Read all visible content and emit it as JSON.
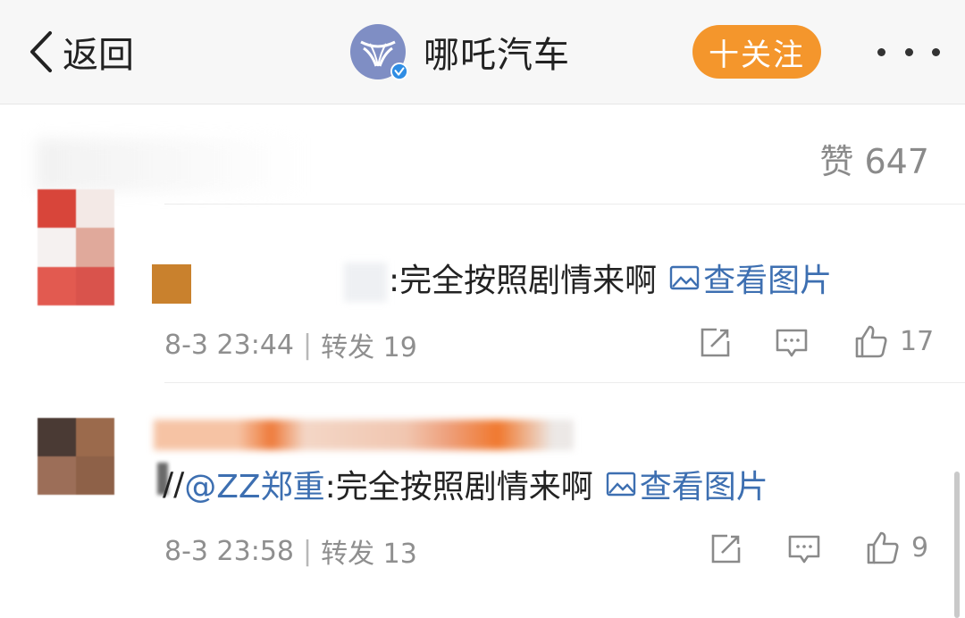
{
  "nav": {
    "back_label": "返回",
    "account_name": "哪吒汽车",
    "follow_label": "十关注",
    "brand_color": "#7f8ec4",
    "follow_color": "#f4962c"
  },
  "post": {
    "likes_label": "赞 647"
  },
  "comments": [
    {
      "text": ":完全按照剧情来啊",
      "image_link": "查看图片",
      "time": "8-3 23:44",
      "repost": "转发 19",
      "like_count": "17"
    },
    {
      "prefix": "//",
      "mention": "@ZZ郑重",
      "text": ":完全按照剧情来啊",
      "image_link": "查看图片",
      "time": "8-3 23:58",
      "repost": "转发 13",
      "like_count": "9"
    }
  ],
  "icons": [
    "back-chevron-icon",
    "brand-logo-icon",
    "verified-badge-icon",
    "more-icon",
    "image-icon",
    "share-icon",
    "comment-icon",
    "thumb-up-icon"
  ]
}
